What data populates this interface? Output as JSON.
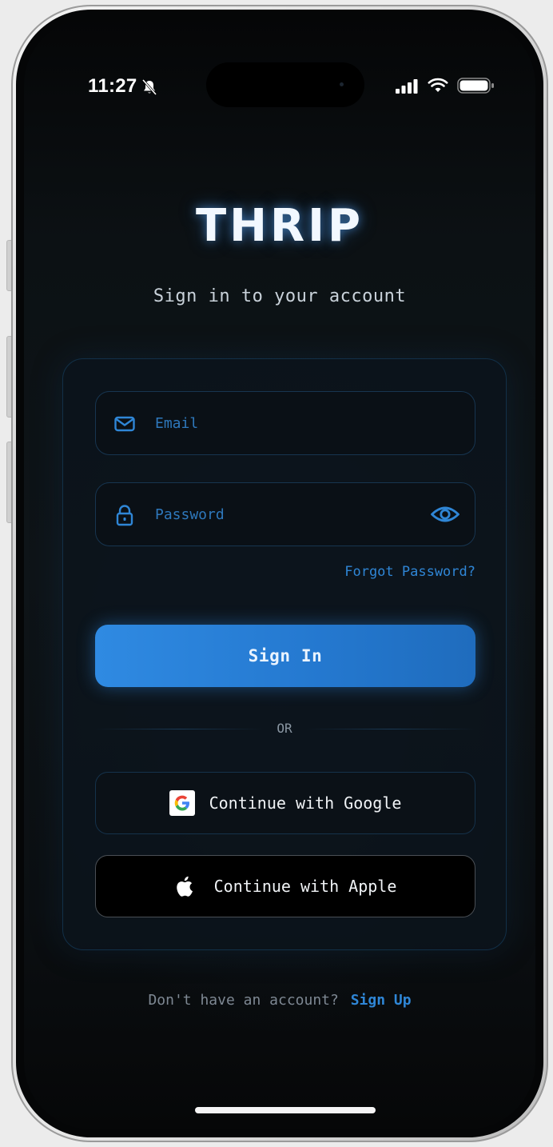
{
  "status_bar": {
    "time": "11:27",
    "icons": [
      "bell-slash-icon",
      "cellular-signal-icon",
      "wifi-icon",
      "battery-icon"
    ]
  },
  "app": {
    "logo": "THRIP",
    "subtitle": "Sign in to your account"
  },
  "form": {
    "email_placeholder": "Email",
    "password_placeholder": "Password",
    "forgot_password": "Forgot Password?",
    "sign_in_label": "Sign In",
    "separator": "OR",
    "google_label": "Continue with Google",
    "apple_label": "Continue with Apple"
  },
  "footer": {
    "prompt": "Don't have an account?",
    "sign_up": "Sign Up"
  },
  "colors": {
    "accent": "#2f86d6",
    "button": "#2f8ae2",
    "background": "#0c1114",
    "card_border": "#123048"
  }
}
